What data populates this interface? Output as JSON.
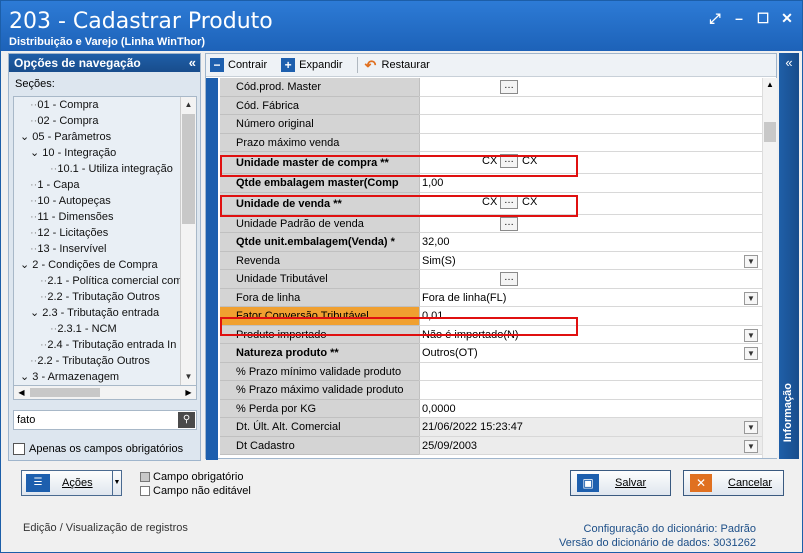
{
  "window": {
    "title": "203 - Cadastrar  Produto",
    "subtitle": "Distribuição e Varejo (Linha WinThor)"
  },
  "left_panel": {
    "header": "Opções de navegação",
    "sections_label": "Seções:",
    "tree": [
      {
        "label": "01 - Compra",
        "indent": 1
      },
      {
        "label": "02 - Compra",
        "indent": 1
      },
      {
        "label": "05 - Parâmetros",
        "indent": 0,
        "toggle": "⌄"
      },
      {
        "label": "10 - Integração",
        "indent": 1,
        "toggle": "⌄"
      },
      {
        "label": "10.1 - Utiliza integração",
        "indent": 3
      },
      {
        "label": "1 - Capa",
        "indent": 1
      },
      {
        "label": "10 - Autopeças",
        "indent": 1
      },
      {
        "label": "11 - Dimensões",
        "indent": 1
      },
      {
        "label": "12 - Licitações",
        "indent": 1
      },
      {
        "label": "13 - Inservível",
        "indent": 1
      },
      {
        "label": "2 - Condições de Compra",
        "indent": 0,
        "toggle": "⌄"
      },
      {
        "label": "2.1 - Política comercial com",
        "indent": 2
      },
      {
        "label": "2.2 - Tributação Outros",
        "indent": 2
      },
      {
        "label": "2.3 - Tributação entrada",
        "indent": 1,
        "toggle": "⌄"
      },
      {
        "label": "2.3.1 - NCM",
        "indent": 3
      },
      {
        "label": "2.4 - Tributação entrada In",
        "indent": 2
      },
      {
        "label": "2.2 - Tributação Outros",
        "indent": 1
      },
      {
        "label": "3 - Armazenagem",
        "indent": 0,
        "toggle": "⌄"
      }
    ],
    "search_value": "fato",
    "only_required_label": "Apenas os campos obrigatórios"
  },
  "toolbar": {
    "collapse_label": "Contrair",
    "expand_label": "Expandir",
    "restore_label": "Restaurar"
  },
  "fields": [
    {
      "label": "Cód.prod. Master",
      "value": "",
      "ellipsis": true
    },
    {
      "label": "Cód. Fábrica",
      "value": ""
    },
    {
      "label": "Número original",
      "value": ""
    },
    {
      "label": "Prazo máximo venda",
      "value": ""
    },
    {
      "label": "Unidade master de compra **",
      "value": "CX",
      "value2": "CX",
      "ellipsis": true,
      "bold": true
    },
    {
      "label": "Qtde embalagem master(Comp",
      "value": "1,00",
      "bold": true
    },
    {
      "label": "Unidade de venda **",
      "value": "CX",
      "value2": "CX",
      "ellipsis": true,
      "bold": true
    },
    {
      "label": "Unidade Padrão de venda",
      "value": "",
      "ellipsis": true
    },
    {
      "label": "Qtde unit.embalagem(Venda) *",
      "value": "32,00",
      "bold": true
    },
    {
      "label": "Revenda",
      "value": "Sim(S)",
      "dropdown": true
    },
    {
      "label": "Unidade Tributável",
      "value": "",
      "ellipsis": true
    },
    {
      "label": "Fora de linha",
      "value": "Fora de linha(FL)",
      "dropdown": true
    },
    {
      "label": "Fator Conversão Tributável",
      "value": "0,01",
      "highlight": true
    },
    {
      "label": "Produto importado",
      "value": "Não é importado(N)",
      "dropdown": true
    },
    {
      "label": "Natureza produto **",
      "value": "Outros(OT)",
      "dropdown": true,
      "bold": true
    },
    {
      "label": "% Prazo mínimo validade produto",
      "value": ""
    },
    {
      "label": "% Prazo máximo validade produto",
      "value": ""
    },
    {
      "label": "% Perda por KG",
      "value": "0,0000"
    },
    {
      "label": "Dt. Últ. Alt. Comercial",
      "value": "21/06/2022 15:23:47",
      "dropdown": true,
      "grey": true
    },
    {
      "label": "Dt Cadastro",
      "value": "25/09/2003",
      "dropdown": true,
      "grey": true
    }
  ],
  "right_panel": {
    "label": "Informação"
  },
  "buttons": {
    "actions_label": "Ações",
    "save_label": "Salvar",
    "cancel_label": "Cancelar"
  },
  "legend": {
    "required": "Campo obrigatório",
    "not_editable": "Campo não editável"
  },
  "footer": {
    "mode": "Edição / Visualização de registros",
    "dict_config_label": "Configuração do dicionário:",
    "dict_config_value": "Padrão",
    "dict_version_label": "Versão do dicionário de dados:",
    "dict_version_value": "3031262"
  },
  "colors": {
    "title_blue": "#1d62b8",
    "highlight_orange": "#f0a030",
    "annotation_red": "#e01010"
  }
}
